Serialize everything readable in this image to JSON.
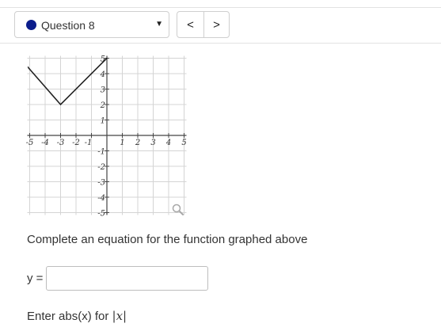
{
  "header": {
    "question_label": "Question 8",
    "dropdown_caret": "▼",
    "prev_label": "<",
    "next_label": ">",
    "status_color": "#0b1d8c"
  },
  "graph": {
    "x_ticks": [
      "-5",
      "-4",
      "-3",
      "-2",
      "-1",
      "1",
      "2",
      "3",
      "4",
      "5"
    ],
    "y_ticks": [
      "5",
      "4",
      "3",
      "2",
      "1",
      "-1",
      "-2",
      "-3",
      "-4",
      "-5"
    ],
    "zoom_icon": "magnifier-icon",
    "line_color": "#222222"
  },
  "chart_data": {
    "type": "line",
    "x": [
      -6.5,
      -3,
      2
    ],
    "y": [
      6,
      2,
      7
    ],
    "xlim": [
      -5,
      5
    ],
    "ylim": [
      -5,
      5
    ],
    "grid": true
  },
  "main": {
    "prompt": "Complete an equation for the function graphed above",
    "y_label": "y =",
    "answer_value": "",
    "hint_prefix": "Enter abs(x) for ",
    "hint_math": "|x|"
  }
}
